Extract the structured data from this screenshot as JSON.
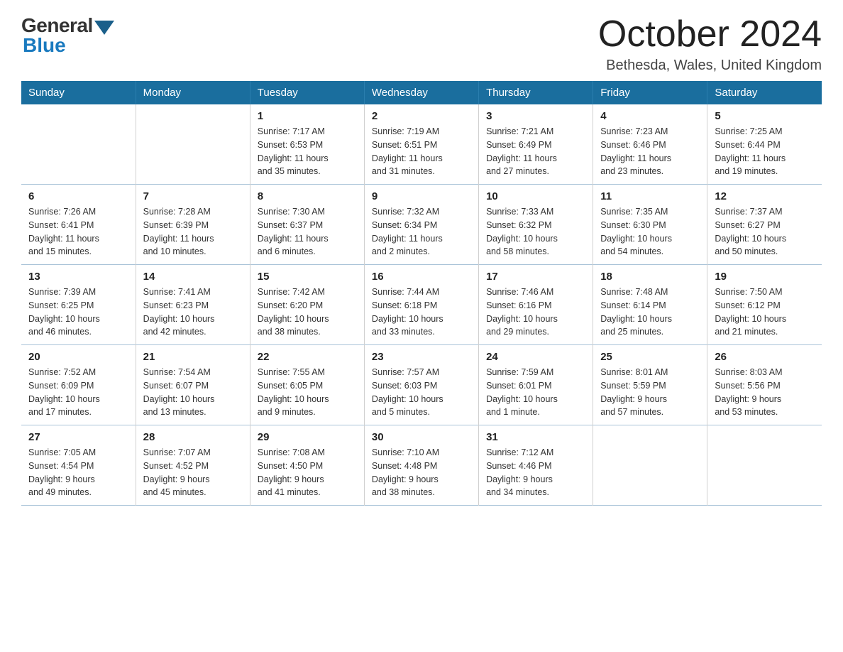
{
  "logo": {
    "general": "General",
    "blue": "Blue"
  },
  "title": "October 2024",
  "location": "Bethesda, Wales, United Kingdom",
  "days_of_week": [
    "Sunday",
    "Monday",
    "Tuesday",
    "Wednesday",
    "Thursday",
    "Friday",
    "Saturday"
  ],
  "weeks": [
    [
      {
        "day": "",
        "info": ""
      },
      {
        "day": "",
        "info": ""
      },
      {
        "day": "1",
        "info": "Sunrise: 7:17 AM\nSunset: 6:53 PM\nDaylight: 11 hours\nand 35 minutes."
      },
      {
        "day": "2",
        "info": "Sunrise: 7:19 AM\nSunset: 6:51 PM\nDaylight: 11 hours\nand 31 minutes."
      },
      {
        "day": "3",
        "info": "Sunrise: 7:21 AM\nSunset: 6:49 PM\nDaylight: 11 hours\nand 27 minutes."
      },
      {
        "day": "4",
        "info": "Sunrise: 7:23 AM\nSunset: 6:46 PM\nDaylight: 11 hours\nand 23 minutes."
      },
      {
        "day": "5",
        "info": "Sunrise: 7:25 AM\nSunset: 6:44 PM\nDaylight: 11 hours\nand 19 minutes."
      }
    ],
    [
      {
        "day": "6",
        "info": "Sunrise: 7:26 AM\nSunset: 6:41 PM\nDaylight: 11 hours\nand 15 minutes."
      },
      {
        "day": "7",
        "info": "Sunrise: 7:28 AM\nSunset: 6:39 PM\nDaylight: 11 hours\nand 10 minutes."
      },
      {
        "day": "8",
        "info": "Sunrise: 7:30 AM\nSunset: 6:37 PM\nDaylight: 11 hours\nand 6 minutes."
      },
      {
        "day": "9",
        "info": "Sunrise: 7:32 AM\nSunset: 6:34 PM\nDaylight: 11 hours\nand 2 minutes."
      },
      {
        "day": "10",
        "info": "Sunrise: 7:33 AM\nSunset: 6:32 PM\nDaylight: 10 hours\nand 58 minutes."
      },
      {
        "day": "11",
        "info": "Sunrise: 7:35 AM\nSunset: 6:30 PM\nDaylight: 10 hours\nand 54 minutes."
      },
      {
        "day": "12",
        "info": "Sunrise: 7:37 AM\nSunset: 6:27 PM\nDaylight: 10 hours\nand 50 minutes."
      }
    ],
    [
      {
        "day": "13",
        "info": "Sunrise: 7:39 AM\nSunset: 6:25 PM\nDaylight: 10 hours\nand 46 minutes."
      },
      {
        "day": "14",
        "info": "Sunrise: 7:41 AM\nSunset: 6:23 PM\nDaylight: 10 hours\nand 42 minutes."
      },
      {
        "day": "15",
        "info": "Sunrise: 7:42 AM\nSunset: 6:20 PM\nDaylight: 10 hours\nand 38 minutes."
      },
      {
        "day": "16",
        "info": "Sunrise: 7:44 AM\nSunset: 6:18 PM\nDaylight: 10 hours\nand 33 minutes."
      },
      {
        "day": "17",
        "info": "Sunrise: 7:46 AM\nSunset: 6:16 PM\nDaylight: 10 hours\nand 29 minutes."
      },
      {
        "day": "18",
        "info": "Sunrise: 7:48 AM\nSunset: 6:14 PM\nDaylight: 10 hours\nand 25 minutes."
      },
      {
        "day": "19",
        "info": "Sunrise: 7:50 AM\nSunset: 6:12 PM\nDaylight: 10 hours\nand 21 minutes."
      }
    ],
    [
      {
        "day": "20",
        "info": "Sunrise: 7:52 AM\nSunset: 6:09 PM\nDaylight: 10 hours\nand 17 minutes."
      },
      {
        "day": "21",
        "info": "Sunrise: 7:54 AM\nSunset: 6:07 PM\nDaylight: 10 hours\nand 13 minutes."
      },
      {
        "day": "22",
        "info": "Sunrise: 7:55 AM\nSunset: 6:05 PM\nDaylight: 10 hours\nand 9 minutes."
      },
      {
        "day": "23",
        "info": "Sunrise: 7:57 AM\nSunset: 6:03 PM\nDaylight: 10 hours\nand 5 minutes."
      },
      {
        "day": "24",
        "info": "Sunrise: 7:59 AM\nSunset: 6:01 PM\nDaylight: 10 hours\nand 1 minute."
      },
      {
        "day": "25",
        "info": "Sunrise: 8:01 AM\nSunset: 5:59 PM\nDaylight: 9 hours\nand 57 minutes."
      },
      {
        "day": "26",
        "info": "Sunrise: 8:03 AM\nSunset: 5:56 PM\nDaylight: 9 hours\nand 53 minutes."
      }
    ],
    [
      {
        "day": "27",
        "info": "Sunrise: 7:05 AM\nSunset: 4:54 PM\nDaylight: 9 hours\nand 49 minutes."
      },
      {
        "day": "28",
        "info": "Sunrise: 7:07 AM\nSunset: 4:52 PM\nDaylight: 9 hours\nand 45 minutes."
      },
      {
        "day": "29",
        "info": "Sunrise: 7:08 AM\nSunset: 4:50 PM\nDaylight: 9 hours\nand 41 minutes."
      },
      {
        "day": "30",
        "info": "Sunrise: 7:10 AM\nSunset: 4:48 PM\nDaylight: 9 hours\nand 38 minutes."
      },
      {
        "day": "31",
        "info": "Sunrise: 7:12 AM\nSunset: 4:46 PM\nDaylight: 9 hours\nand 34 minutes."
      },
      {
        "day": "",
        "info": ""
      },
      {
        "day": "",
        "info": ""
      }
    ]
  ]
}
